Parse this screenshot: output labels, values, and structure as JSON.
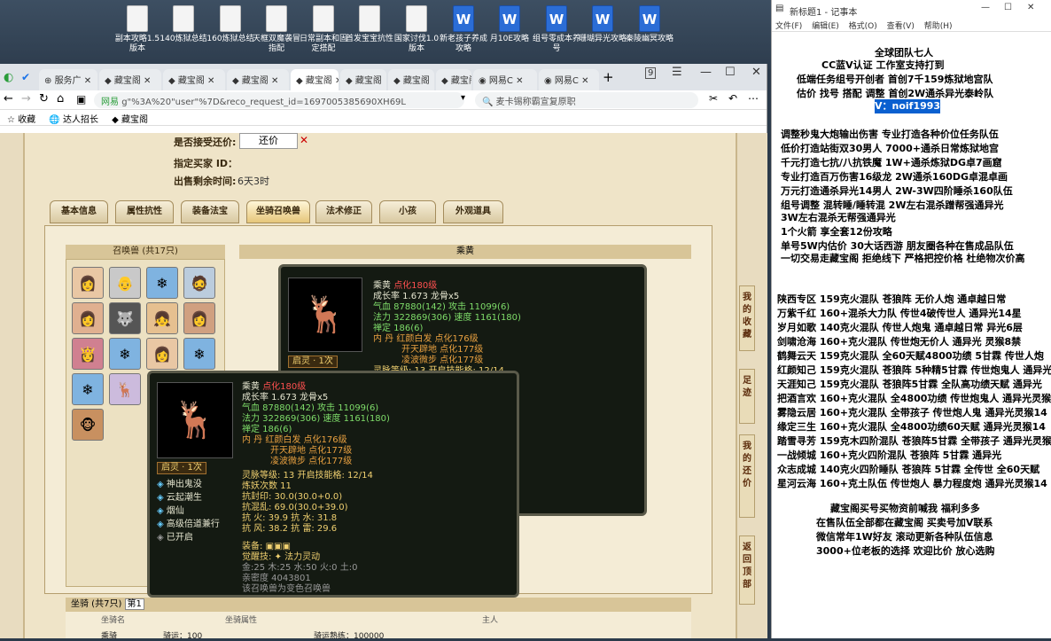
{
  "desktop": {
    "icons": [
      "副本攻略1.5版本",
      "140炼狱总结",
      "160炼狱总结",
      "天框双魔袭冒指配",
      "日常副本和固定搭配",
      "首发宝宝抗性",
      "国家讨伐1.0版本",
      "新老孩子养成攻略",
      "月10E攻略",
      "组号零成本养号",
      "珊瑚异光攻略",
      "秦陵幽冥攻略"
    ]
  },
  "browser": {
    "tabs": [
      "服务广",
      "藏宝阁",
      "藏宝阁",
      "藏宝阁",
      "藏宝阁",
      "藏宝阁",
      "藏宝阁",
      "藏宝阁",
      "网易C",
      "网易C"
    ],
    "url": "g\"%3A%20\"user\"%7D&reco_request_id=1697005385690XH69L",
    "search_placeholder": "麦卡锡称霸宣复原职",
    "site_label": "网易",
    "bookmarks": [
      "收藏",
      "达人招长",
      "藏宝阁"
    ]
  },
  "game": {
    "accept_offer_label": "是否接受还价:",
    "accept_offer_btn": "还价",
    "buyer_label": "指定买家 ID：",
    "remaining_label": "出售剩余时间:",
    "remaining_value": "6天3时",
    "tabs": [
      "基本信息",
      "属性抗性",
      "装备法宝",
      "坐骑召唤兽",
      "法术修正",
      "小孩",
      "外观道具"
    ],
    "pets_header": "召唤兽 (共17只)",
    "ride_header": "乘黄",
    "bottom_header": "坐骑 (共7只)",
    "bottom_sub": "第1",
    "bottom_row": [
      "坐骑名",
      "坐骑属性",
      "主人"
    ],
    "bottom_row2": [
      "乘骑",
      "骑运：100",
      "骑运熟练：100000"
    ],
    "side_buttons": [
      "我的收藏",
      "足迹",
      "我的还价",
      "返回顶部"
    ]
  },
  "tip1": {
    "name": "乘黄",
    "tag": "点化180级",
    "growth": "成长率 1.673 龙骨x5",
    "hp": "气血 87880(142) 攻击 11099(6)",
    "mp": "法力 322869(306) 速度 1161(180)",
    "zen": "禅定 186(6)",
    "inner": "内 丹 红颜白发 点化176级",
    "inner2": "开天辟地 点化177级",
    "inner3": "凌波微步 点化177级",
    "spirit": "灵脉等级: 13 开启技能格: 12/14",
    "badge": "启灵 · 1次"
  },
  "tip2": {
    "name": "乘黄",
    "tag": "点化180级",
    "growth": "成长率 1.673 龙骨x5",
    "hp": "气血 87880(142) 攻击 11099(6)",
    "mp": "法力 322869(306) 速度 1161(180)",
    "zen": "禅定 186(6)",
    "inner": "内 丹 红颜白发 点化176级",
    "inner2": "开天辟地 点化177级",
    "inner3": "凌波微步 点化177级",
    "badge": "启灵 · 1次",
    "skills": [
      "神出鬼没",
      "云起潮生",
      "烟仙",
      "高级倍道兼行",
      "已开启"
    ],
    "spirit": "灵脉等级: 13 开启技能格: 12/14",
    "refine": "炼妖次数 11",
    "seal": "抗封印: 30.0(30.0+0.0)",
    "conf": "抗混乱: 69.0(30.0+39.0)",
    "res1": "抗 火: 39.9 抗 水: 31.8",
    "res2": "抗 风: 38.2 抗 雷: 29.6",
    "equip": "装备:",
    "awake_label": "觉醒技:",
    "awake": "法力灵动",
    "elements": "金:25 木:25 水:50 火:0 土:0",
    "intimacy": "亲密度 4043801",
    "note": "该召唤兽为变色召唤兽"
  },
  "notepad": {
    "title": "新标题1 - 记事本",
    "menu": [
      "文件(F)",
      "编辑(E)",
      "格式(O)",
      "查看(V)",
      "帮助(H)"
    ],
    "lines": [
      "全球团队七人",
      "CC蓝V认证     工作室支持打到",
      "低端任务组号开创者        首创7千159炼狱地宫队",
      "估价 找号 搭配 调整       首创2W通杀异光泰岭队",
      "V：noif1993",
      "调整秒鬼大炮输出伤害          专业打造各种价位任务队伍",
      "低价打造站街双30男人              7000+通杀日常炼狱地宫",
      "千元打造七抗/八抗铁魔           1W+通杀炼狱DG卓7画窟",
      "专业打造百万伤害16级龙          2W通杀160DG卓混卓画",
      "万元打造通杀异光14男人          2W-3W四阶睡杀160队伍",
      "组号调整 混转睡/睡转混          2W左右混杀蹭帮强通异光",
      "                                   3W左右混杀无帮强通异光",
      "1个火箭 享全套12份攻略",
      "单号5W内估价 30大话西游        朋友圈各种在售成品队伍",
      "一切交易走藏宝阁 拒绝线下     严格把控价格 杜绝物次价高",
      "陕西专区 159克火混队 苍狼阵 无价人炮 通卓越日常",
      "万紫千红 160+混杀大力队 传世4破传世人 通异光14星",
      "岁月如歌 140克火混队 传世人炮鬼 通卓越日常 异光6层",
      "剑啸沧海 160+克火混队 传世炮无价人 通异光 灵猴8禁",
      "鹤舞云天 159克火混队 全60天赋4800功绩 5甘霖 传世人炮",
      "红颜知己 159克火混队 苍狼阵 5种精5甘霖 传世炮鬼人 通异光",
      "天涯知己 159克火混队 苍狼阵5甘霖 全队高功绩天赋 通异光",
      "把酒言欢 160+克火混队 全4800功绩 传世炮鬼人 通异光灵猴",
      "雾隐云居 160+克火混队 全带孩子 传世炮人鬼 通异光灵猴14",
      "缘定三生 160+克火混队 全4800功绩60天赋 通异光灵猴14",
      "踏雪寻芳 159克木四阶混队 苍狼阵5甘霖 全带孩子 通异光灵猴",
      "一战倾城 160+克火四阶混队 苍狼阵 5甘霖 通异光",
      "众志成城 140克火四阶睡队 苍狼阵 5甘霖 全传世 全60天赋",
      "星河云海 160+克土队伍 传世炮人 暴力程度炮 通异光灵猴14",
      "藏宝阁买号买物资前喊我 福利多多",
      "在售队伍全部都在藏宝阁 买卖号加V联系",
      "微信常年1W好友 滚动更新各种队伍信息",
      "3000+位老板的选择 欢迎比价 放心选购"
    ]
  }
}
